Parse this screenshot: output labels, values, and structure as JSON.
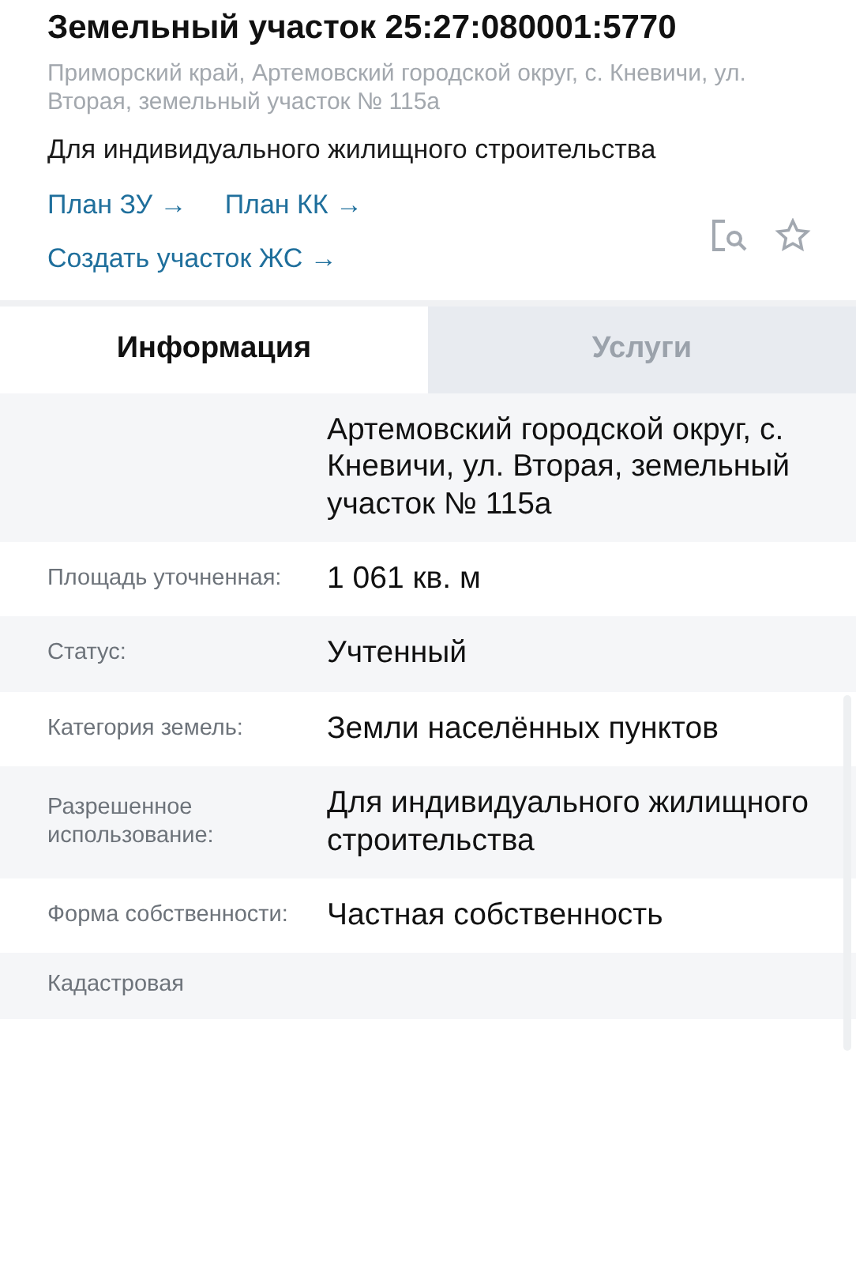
{
  "header": {
    "title": "Земельный участок 25:27:080001:5770",
    "address": "Приморский край, Артемовский городской округ, с. Кневичи, ул. Вторая, земельный участок № 115а",
    "purpose": "Для индивидуального жилищного строительства",
    "links": [
      {
        "label": "План ЗУ",
        "arrow": "→"
      },
      {
        "label": "План КК",
        "arrow": "→"
      },
      {
        "label": "Создать участок ЖС",
        "arrow": "→"
      }
    ]
  },
  "tabs": [
    {
      "label": "Информация",
      "selected": true
    },
    {
      "label": "Услуги",
      "selected": false
    }
  ],
  "rows": [
    {
      "value": "Артемовский городской округ, с. Кневичи, ул. Вторая, земельный участок № 115а"
    },
    {
      "label": "Площадь уточненная:",
      "value": "1 061 кв. м"
    },
    {
      "label": "Статус:",
      "value": "Учтенный"
    },
    {
      "label": "Категория земель:",
      "value": "Земли населённых пунктов"
    },
    {
      "label": "Разрешенное использование:",
      "value": "Для индивидуального жилищного строительства"
    },
    {
      "label": "Форма собственности:",
      "value": "Частная собственность"
    },
    {
      "label": "Кадастровая"
    }
  ]
}
